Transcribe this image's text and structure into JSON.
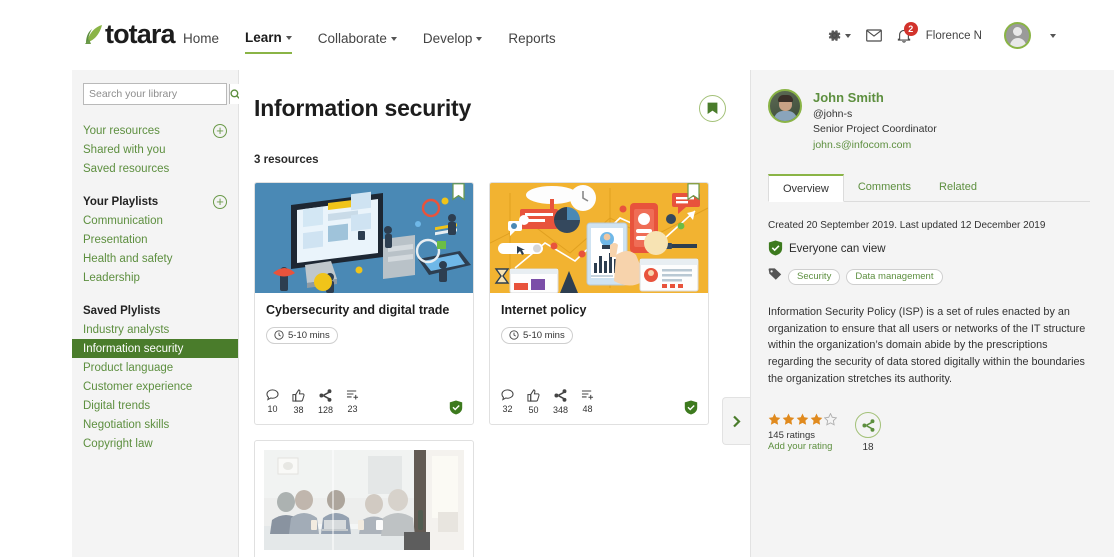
{
  "header": {
    "brand": "totara",
    "brand_icon": "leaf-logo-icon",
    "nav": [
      {
        "label": "Home",
        "has_caret": false,
        "active": false
      },
      {
        "label": "Learn",
        "has_caret": true,
        "active": true
      },
      {
        "label": "Collaborate",
        "has_caret": true,
        "active": false
      },
      {
        "label": "Develop",
        "has_caret": true,
        "active": false
      },
      {
        "label": "Reports",
        "has_caret": false,
        "active": false
      }
    ],
    "settings_icon": "gear-icon",
    "messages_icon": "envelope-icon",
    "notifications_icon": "bell-icon",
    "notification_count": "2",
    "user_name": "Florence N",
    "user_avatar_icon": "user-avatar-icon",
    "user_caret_icon": "chevron-down-icon"
  },
  "sidebar": {
    "search": {
      "placeholder": "Search your library",
      "value": "",
      "button_icon": "search-icon"
    },
    "resources": [
      {
        "label": "Your resources",
        "add": true
      },
      {
        "label": "Shared with you",
        "add": false
      },
      {
        "label": "Saved resources",
        "add": false
      }
    ],
    "playlists_heading": "Your Playlists",
    "playlists_add": "+",
    "playlists": [
      {
        "label": "Communication"
      },
      {
        "label": "Presentation"
      },
      {
        "label": "Health and safety"
      },
      {
        "label": "Leadership"
      }
    ],
    "saved_heading": "Saved Plylists",
    "saved": [
      {
        "label": "Industry analysts",
        "selected": false
      },
      {
        "label": "Information security",
        "selected": true
      },
      {
        "label": "Product language",
        "selected": false
      },
      {
        "label": "Customer experience",
        "selected": false
      },
      {
        "label": "Digital trends",
        "selected": false
      },
      {
        "label": "Negotiation skills",
        "selected": false
      },
      {
        "label": "Copyright law",
        "selected": false
      }
    ]
  },
  "main": {
    "title": "Information security",
    "bookmark_icon": "bookmark-icon",
    "resource_count": "3 resources",
    "cards": [
      {
        "title": "Cybersecurity and digital trade",
        "duration": "5-10 mins",
        "duration_icon": "clock-icon",
        "ribbon_icon": "bookmark-outline-icon",
        "image_style": "isometric-blue-cybersecurity",
        "stats": [
          {
            "icon": "comment-icon",
            "value": "10"
          },
          {
            "icon": "like-icon",
            "value": "38"
          },
          {
            "icon": "share-icon",
            "value": "128"
          },
          {
            "icon": "add-to-playlist-icon",
            "value": "23"
          }
        ],
        "visibility_icon": "public-shield-icon"
      },
      {
        "title": "Internet policy",
        "duration": "5-10 mins",
        "duration_icon": "clock-icon",
        "ribbon_icon": "bookmark-outline-icon",
        "image_style": "flat-yellow-internet",
        "stats": [
          {
            "icon": "comment-icon",
            "value": "32"
          },
          {
            "icon": "like-icon",
            "value": "50"
          },
          {
            "icon": "share-icon",
            "value": "348"
          },
          {
            "icon": "add-to-playlist-icon",
            "value": "48"
          }
        ],
        "visibility_icon": "public-shield-icon"
      },
      {
        "title": "",
        "duration": "",
        "duration_icon": "",
        "ribbon_icon": "",
        "image_style": "photo-meeting-room",
        "stats": [],
        "visibility_icon": ""
      }
    ]
  },
  "collapse_tab": {
    "icon": "chevron-right-icon"
  },
  "right_panel": {
    "profile": {
      "name": "John Smith",
      "handle": "@john-s",
      "role": "Senior Project Coordinator",
      "email": "john.s@infocom.com",
      "avatar_icon": "user-photo-avatar"
    },
    "tabs": [
      {
        "label": "Overview",
        "active": true
      },
      {
        "label": "Comments",
        "active": false
      },
      {
        "label": "Related",
        "active": false
      }
    ],
    "meta_dates": "Created 20 September 2019. Last updated 12 December 2019",
    "visibility": {
      "icon": "public-shield-icon",
      "label": "Everyone can view"
    },
    "tags_icon": "tag-icon",
    "tags": [
      "Security",
      "Data management"
    ],
    "description": "Information Security Policy (ISP) is a set of rules enacted by an organization to ensure that all users or networks of the IT structure within the organization’s domain abide by the prescriptions regarding the security of data stored digitally within the boundaries the organization stretches its authority.",
    "rating": {
      "stars_filled": 4,
      "stars_total": 5,
      "count_label": "145 ratings",
      "add_label": "Add your rating"
    },
    "share": {
      "icon": "share-icon",
      "count": "18"
    }
  },
  "colors": {
    "brand_green": "#8ab446",
    "link_green": "#5d8f3f",
    "selected_green": "#4a7c2b",
    "badge_red": "#d2332c",
    "star_orange": "#e08a1e",
    "panel_bg": "#f4f4f4"
  }
}
